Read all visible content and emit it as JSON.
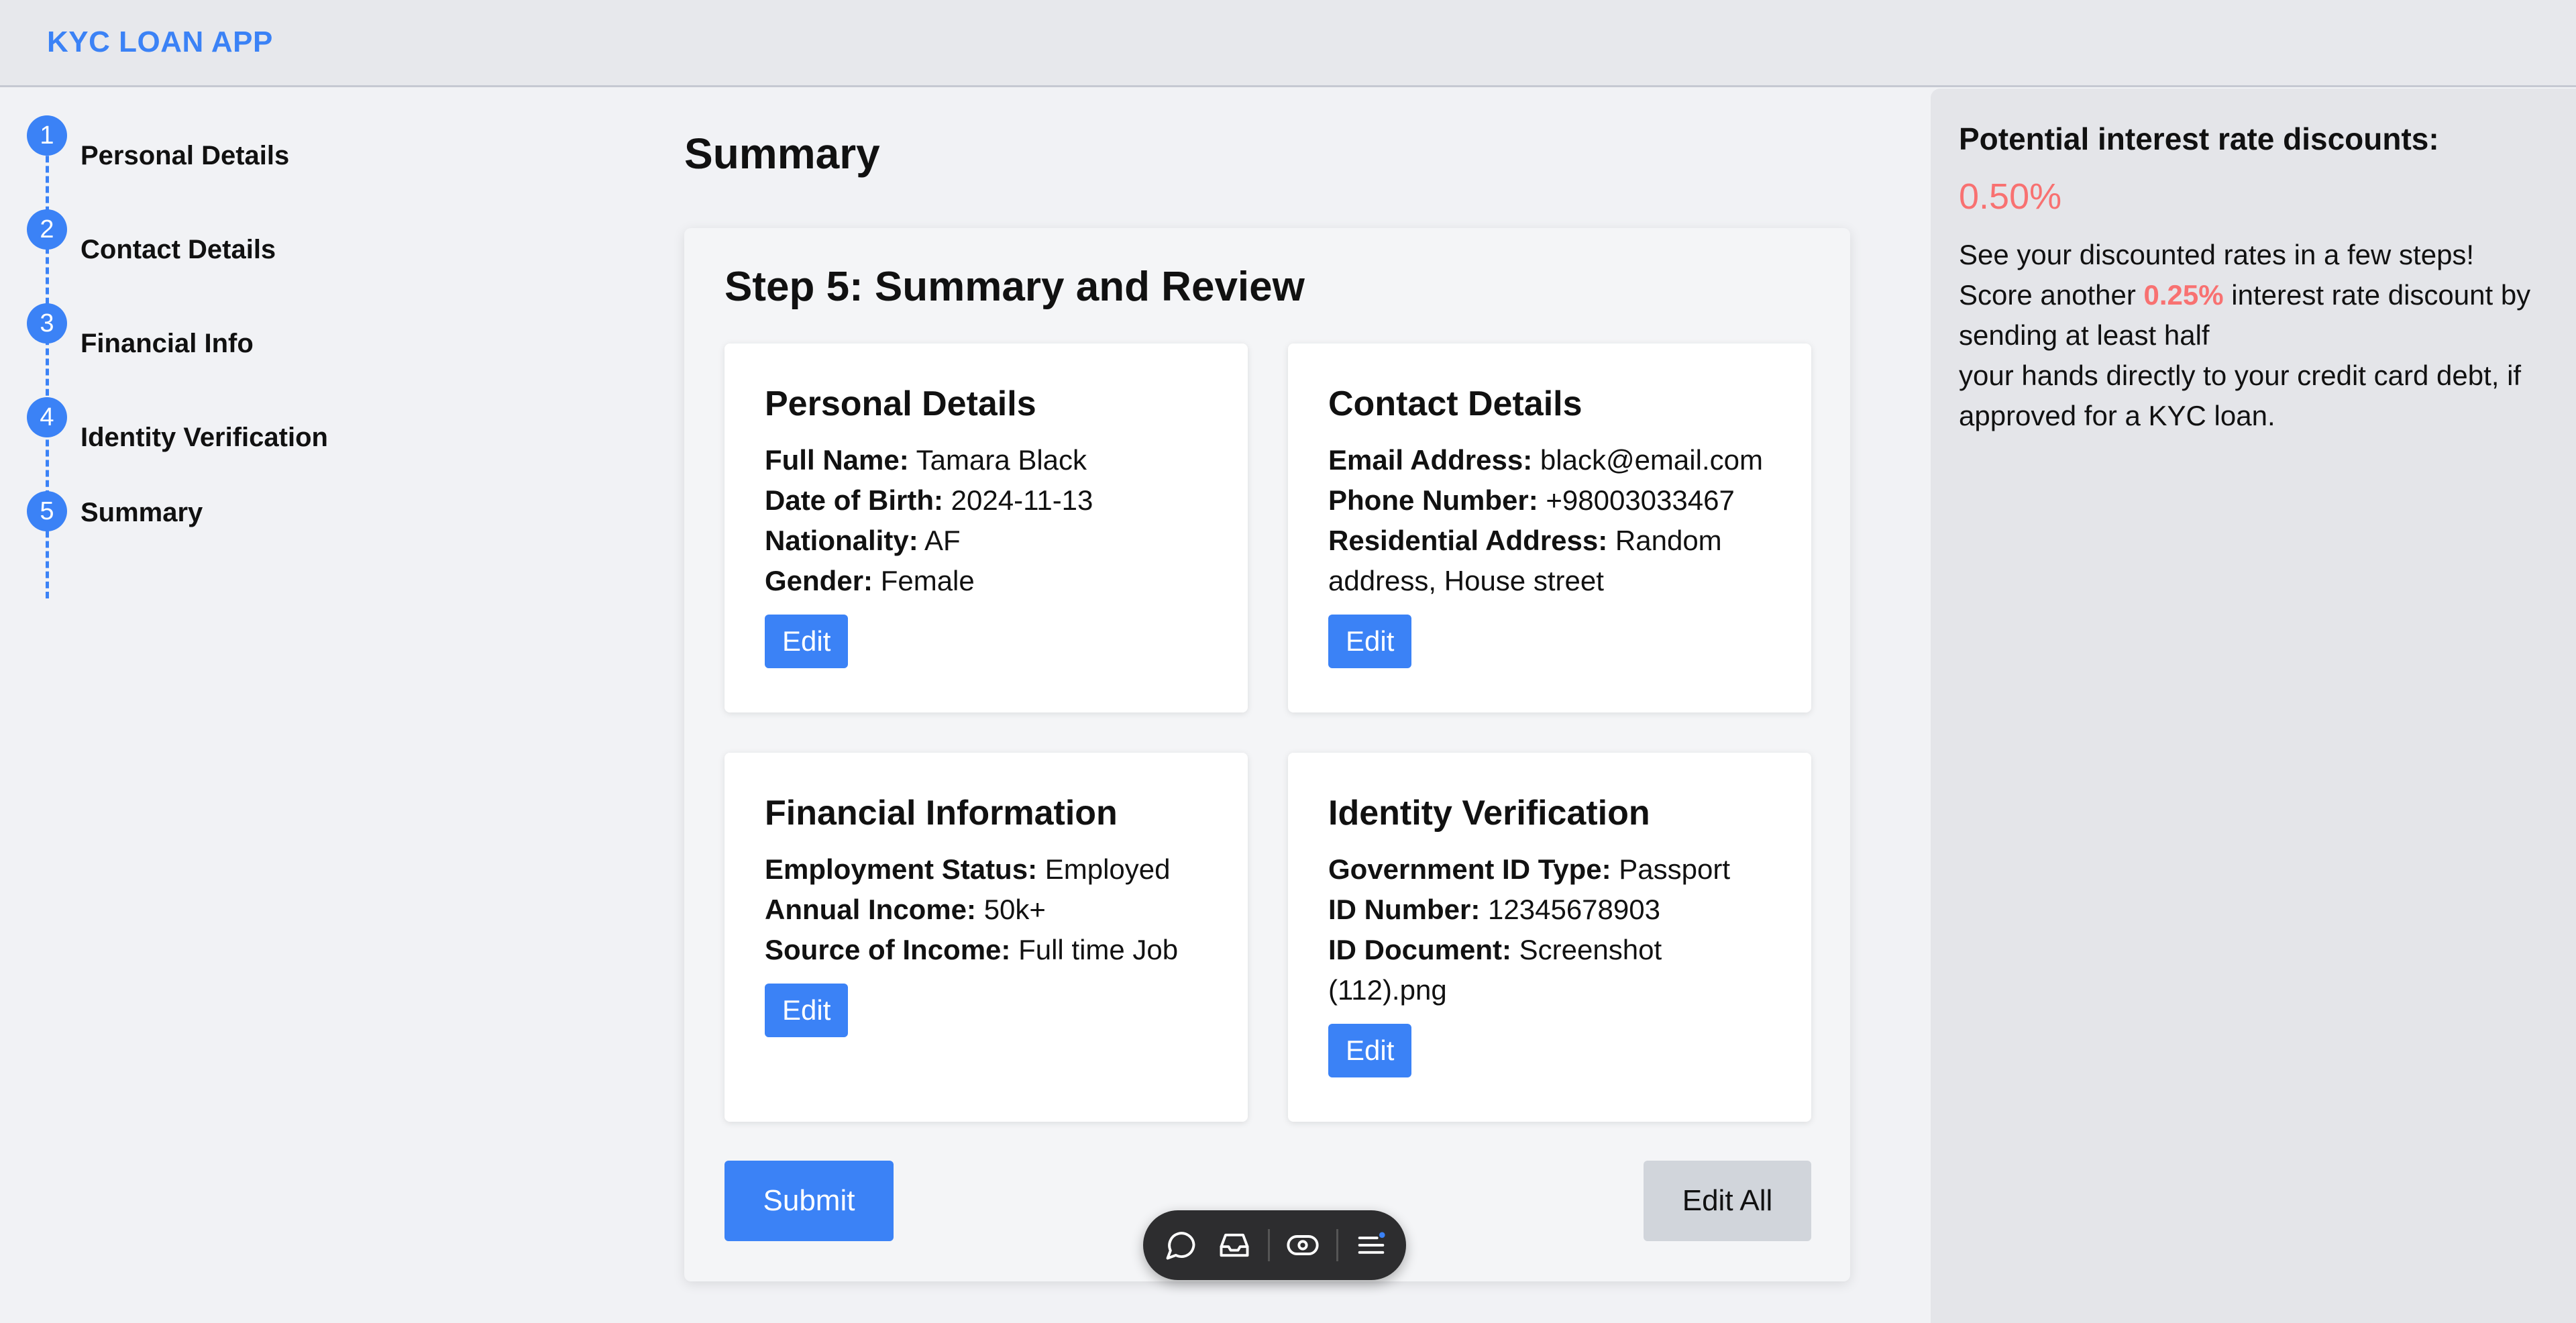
{
  "app": {
    "title": "KYC LOAN APP"
  },
  "stepper": [
    {
      "number": "1",
      "label": "Personal Details"
    },
    {
      "number": "2",
      "label": "Contact Details"
    },
    {
      "number": "3",
      "label": "Financial Info"
    },
    {
      "number": "4",
      "label": "Identity Verification"
    },
    {
      "number": "5",
      "label": "Summary"
    }
  ],
  "main": {
    "title": "Summary",
    "step_title": "Step 5: Summary and Review",
    "cards": {
      "personal": {
        "title": "Personal Details",
        "rows": [
          {
            "label": "Full Name:",
            "value": "Tamara Black"
          },
          {
            "label": "Date of Birth:",
            "value": "2024-11-13"
          },
          {
            "label": "Nationality:",
            "value": "AF"
          },
          {
            "label": "Gender:",
            "value": "Female"
          }
        ],
        "edit_label": "Edit"
      },
      "contact": {
        "title": "Contact Details",
        "rows": [
          {
            "label": "Email Address:",
            "value": "black@email.com"
          },
          {
            "label": "Phone Number:",
            "value": "+98003033467"
          },
          {
            "label": "Residential Address:",
            "value": "Random address, House street"
          }
        ],
        "edit_label": "Edit"
      },
      "financial": {
        "title": "Financial Information",
        "rows": [
          {
            "label": "Employment Status:",
            "value": "Employed"
          },
          {
            "label": "Annual Income:",
            "value": "50k+"
          },
          {
            "label": "Source of Income:",
            "value": "Full time Job"
          }
        ],
        "edit_label": "Edit"
      },
      "identity": {
        "title": "Identity Verification",
        "rows": [
          {
            "label": "Government ID Type:",
            "value": "Passport"
          },
          {
            "label": "ID Number:",
            "value": "12345678903"
          },
          {
            "label": "ID Document:",
            "value": "Screenshot (112).png"
          }
        ],
        "edit_label": "Edit"
      }
    },
    "submit_label": "Submit",
    "edit_all_label": "Edit All"
  },
  "discounts": {
    "title": "Potential interest rate discounts:",
    "rate": "0.50%",
    "line1": "See your discounted rates in a few steps!",
    "line2_pre": "Score another ",
    "line2_rate": "0.25%",
    "line2_post": " interest rate discount by sending at least half",
    "line3": "your hands directly to your credit card debt, if approved for a KYC loan."
  },
  "colors": {
    "accent": "#3b82f6",
    "discount": "#f87171",
    "toolbar": "#2d2d2f"
  },
  "toolbar_icons": [
    "comment-icon",
    "inbox-icon",
    "eye-icon",
    "menu-icon"
  ]
}
